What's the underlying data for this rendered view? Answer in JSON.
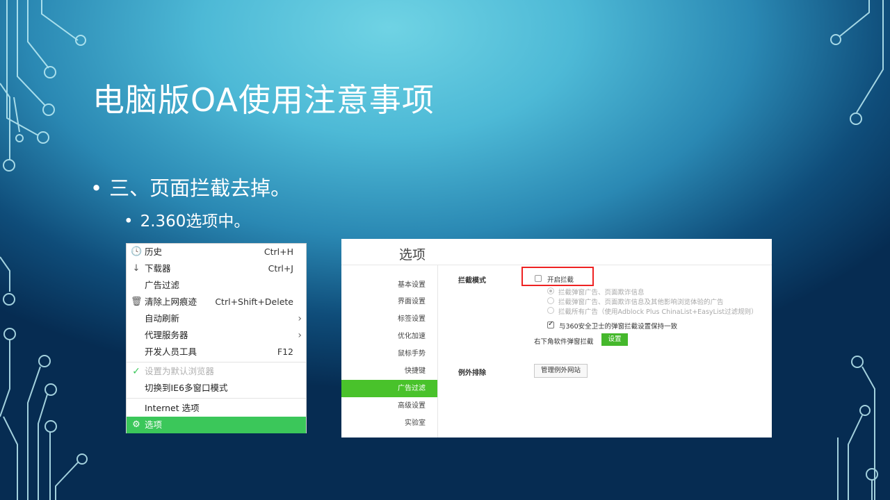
{
  "slide": {
    "title": "电脑版OA使用注意事项",
    "bullet1": "三、页面拦截去掉。",
    "bullet2": "2.360选项中。",
    "bullet_symbol": "•"
  },
  "colors": {
    "accent_green": "#3bc75a",
    "highlight_red": "#e22222",
    "bg_top": "#6fd3e4",
    "bg_bottom": "#062c52"
  },
  "context_menu": {
    "items": [
      {
        "icon": "clock-icon",
        "label": "历史",
        "shortcut": "Ctrl+H"
      },
      {
        "icon": "download-arrow-icon",
        "label": "下载器",
        "shortcut": "Ctrl+J"
      },
      {
        "icon": "",
        "label": "广告过滤",
        "shortcut": ""
      },
      {
        "icon": "trash-icon",
        "label": "清除上网痕迹",
        "shortcut": "Ctrl+Shift+Delete"
      },
      {
        "icon": "",
        "label": "自动刷新",
        "shortcut": "",
        "submenu": true
      },
      {
        "icon": "",
        "label": "代理服务器",
        "shortcut": "",
        "submenu": true
      },
      {
        "icon": "",
        "label": "开发人员工具",
        "shortcut": "F12"
      },
      {
        "icon": "check-icon",
        "label": "设置为默认浏览器",
        "shortcut": "",
        "disabled": true
      },
      {
        "icon": "",
        "label": "切换到IE6多窗口模式",
        "shortcut": ""
      },
      {
        "icon": "",
        "label": "Internet 选项",
        "shortcut": ""
      },
      {
        "icon": "gear-icon",
        "label": "选项",
        "shortcut": "",
        "selected": true
      }
    ]
  },
  "options_panel": {
    "title": "选项",
    "sidebar": [
      "基本设置",
      "界面设置",
      "标签设置",
      "优化加速",
      "鼠标手势",
      "快捷键",
      "广告过滤",
      "高级设置",
      "实验室"
    ],
    "active_item": "广告过滤",
    "block_mode": {
      "label": "拦截模式",
      "enable_checkbox": "开启拦截",
      "enable_checked": false,
      "radio_options": [
        "拦截弹窗广告、页面欺诈信息",
        "拦截弹窗广告、页面欺诈信息及其他影响浏览体验的广告",
        "拦截所有广告（使用Adblock Plus ChinaList+EasyList过滤规则）"
      ],
      "sync_checkbox": "与360安全卫士的弹窗拦截设置保持一致",
      "sync_checked": true,
      "popup_label": "右下角软件弹窗拦截",
      "settings_button": "设置"
    },
    "exceptions": {
      "label": "例外排除",
      "manage_button": "管理例外网站"
    }
  }
}
